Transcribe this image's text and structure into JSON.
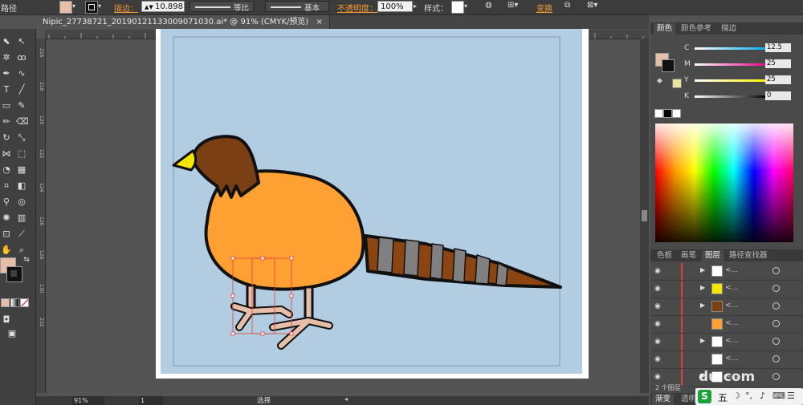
{
  "control_bar": {
    "path_label": "路径",
    "stroke_label": "描边：",
    "stroke_value": "10.898",
    "profile_label": "等比",
    "brush_label": "基本",
    "opacity_label": "不透明度：",
    "opacity_value": "100%",
    "style_label": "样式：",
    "transform_label": "变换",
    "fill_color": "#e7bfa9"
  },
  "document_tab": {
    "title": "Nipic_27738721_20190121133009071030.ai* @ 91% (CMYK/预览)",
    "close": "×"
  },
  "vertical_ruler_labels": [
    "216",
    "218",
    "120",
    "122",
    "124",
    "126",
    "128",
    "130",
    "232"
  ],
  "status_bar": {
    "zoom": "91%",
    "page": "1",
    "mode": "选择"
  },
  "color_panel": {
    "tabs": [
      "颜色",
      "颜色参考",
      "描边"
    ],
    "channels": [
      {
        "label": "C",
        "value": "12.5"
      },
      {
        "label": "M",
        "value": "25"
      },
      {
        "label": "Y",
        "value": "25"
      },
      {
        "label": "K",
        "value": "0"
      }
    ],
    "fill": "#e7bfa9"
  },
  "layers_panel": {
    "tabs": [
      "色板",
      "画笔",
      "图层",
      "路径查找器"
    ],
    "rows": [
      {
        "name": "<...",
        "arrow": "▶"
      },
      {
        "name": "<...",
        "arrow": "▶"
      },
      {
        "name": "<...",
        "arrow": "▶"
      },
      {
        "name": "<...",
        "arrow": ""
      },
      {
        "name": "<...",
        "arrow": "▶"
      },
      {
        "name": "<...",
        "arrow": ""
      },
      {
        "name": "<...",
        "arrow": "▶"
      },
      {
        "name": "<...",
        "arrow": ""
      },
      {
        "name": "<...",
        "arrow": ""
      }
    ],
    "footer": "2 个图层"
  },
  "bottom_tabs": [
    "渐变",
    "透明"
  ],
  "watermark": "du.com",
  "ime": {
    "label": "五"
  }
}
